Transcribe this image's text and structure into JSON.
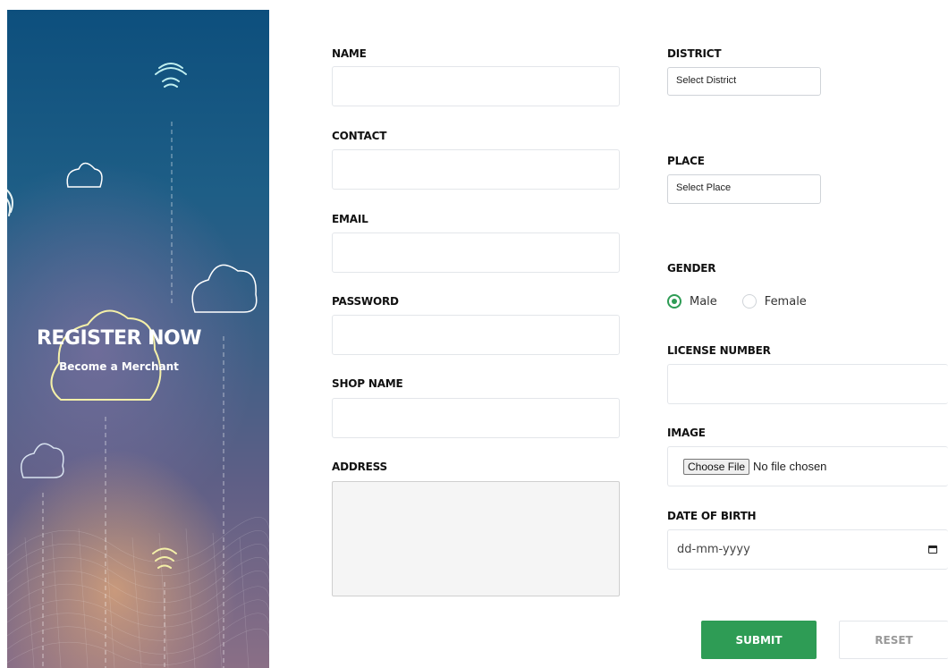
{
  "hero": {
    "title": "REGISTER NOW",
    "subtitle": "Become a Merchant"
  },
  "form": {
    "name_label": "NAME",
    "contact_label": "CONTACT",
    "email_label": "EMAIL",
    "password_label": "PASSWORD",
    "shop_name_label": "SHOP NAME",
    "address_label": "ADDRESS",
    "district_label": "DISTRICT",
    "district_value": "Select District",
    "place_label": "PLACE",
    "place_value": "Select Place",
    "gender_label": "GENDER",
    "gender_options": [
      "Male",
      "Female"
    ],
    "gender_selected": "Male",
    "license_label": "LICENSE NUMBER",
    "image_label": "IMAGE",
    "file_button": "Choose File",
    "file_status": "No file chosen",
    "dob_label": "DATE OF BIRTH",
    "dob_placeholder": "dd-mm-yyyy",
    "submit_label": "SUBMIT",
    "reset_label": "RESET"
  },
  "colors": {
    "accent": "#2e9c55"
  }
}
